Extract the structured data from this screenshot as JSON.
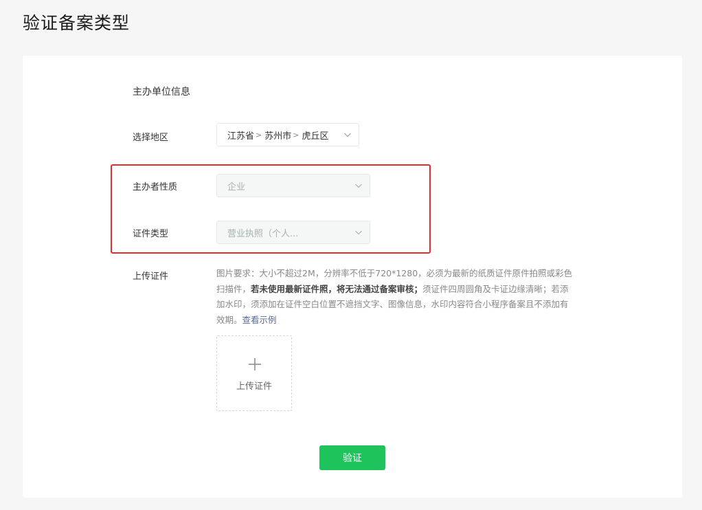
{
  "page": {
    "title": "验证备案类型"
  },
  "form": {
    "section_title": "主办单位信息",
    "region": {
      "label": "选择地区",
      "province": "江苏省",
      "city": "苏州市",
      "district": "虎丘区",
      "separator": ">"
    },
    "nature": {
      "label": "主办者性质",
      "value": "企业"
    },
    "cert_type": {
      "label": "证件类型",
      "value": "营业执照（个人..."
    },
    "upload": {
      "label": "上传证件",
      "req_part1": "图片要求：大小不超过2M，分辨率不低于720*1280，必须为最新的纸质证件原件拍照或彩色扫描件，",
      "req_bold": "若未使用最新证件照，将无法通过备案审核；",
      "req_part2": "须证件四周圆角及卡证边缘清晰；若添加水印，须添加在证件空白位置不遮挡文字、图像信息，水印内容符合小程序备案且不添加有效期。",
      "example_link": "查看示例",
      "box_label": "上传证件"
    },
    "submit_label": "验证"
  },
  "colors": {
    "primary_green": "#1fc35b",
    "highlight_red": "#ea2b2b",
    "link_blue": "#576b95"
  }
}
